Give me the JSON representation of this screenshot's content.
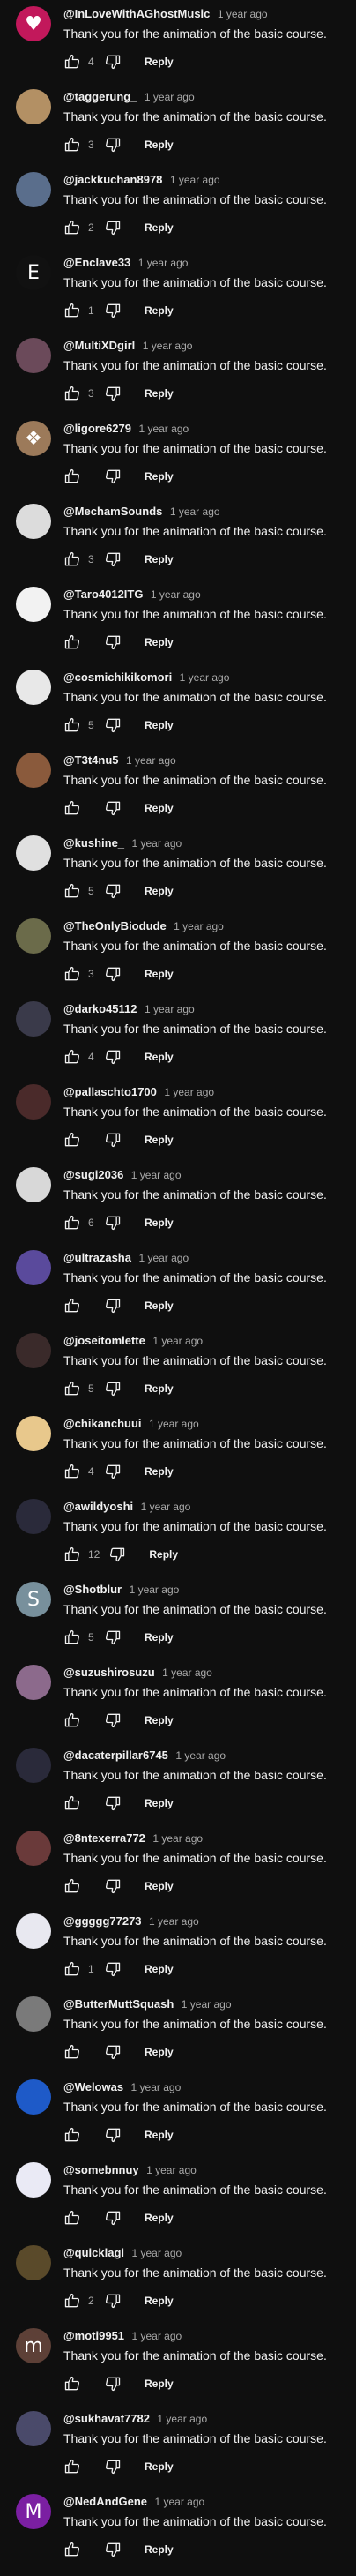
{
  "ui": {
    "reply_label": "Reply",
    "like_icon": "thumb-up-icon",
    "dislike_icon": "thumb-down-icon"
  },
  "comments": [
    {
      "author": "@InLoveWithAGhostMusic",
      "time": "1 year ago",
      "text": "Thank you for the animation of the basic course.",
      "likes": "4",
      "avatar": {
        "bg": "#c2185b",
        "glyph": "♥"
      }
    },
    {
      "author": "@taggerung_",
      "time": "1 year ago",
      "text": "Thank you for the animation of the basic course.",
      "likes": "3",
      "avatar": {
        "bg": "#b39064",
        "glyph": ""
      }
    },
    {
      "author": "@jackkuchan8978",
      "time": "1 year ago",
      "text": "Thank you for the animation of the basic course.",
      "likes": "2",
      "avatar": {
        "bg": "#5a6e8c",
        "glyph": ""
      }
    },
    {
      "author": "@Enclave33",
      "time": "1 year ago",
      "text": "Thank you for the animation of the basic course.",
      "likes": "1",
      "avatar": {
        "bg": "#111111",
        "glyph": "E"
      }
    },
    {
      "author": "@MultiXDgirl",
      "time": "1 year ago",
      "text": "Thank you for the animation of the basic course.",
      "likes": "3",
      "avatar": {
        "bg": "#6b4a5a",
        "glyph": ""
      }
    },
    {
      "author": "@ligore6279",
      "time": "1 year ago",
      "text": "Thank you for the animation of the basic course.",
      "likes": "",
      "avatar": {
        "bg": "#9c7a5a",
        "glyph": "❖"
      }
    },
    {
      "author": "@MechamSounds",
      "time": "1 year ago",
      "text": "Thank you for the animation of the basic course.",
      "likes": "3",
      "avatar": {
        "bg": "#dcdcdc",
        "glyph": ""
      }
    },
    {
      "author": "@Taro4012ITG",
      "time": "1 year ago",
      "text": "Thank you for the animation of the basic course.",
      "likes": "",
      "avatar": {
        "bg": "#f2f2f2",
        "glyph": ""
      }
    },
    {
      "author": "@cosmichikikomori",
      "time": "1 year ago",
      "text": "Thank you for the animation of the basic course.",
      "likes": "5",
      "avatar": {
        "bg": "#e8e8e8",
        "glyph": ""
      }
    },
    {
      "author": "@T3t4nu5",
      "time": "1 year ago",
      "text": "Thank you for the animation of the basic course.",
      "likes": "",
      "avatar": {
        "bg": "#8a5a3c",
        "glyph": ""
      }
    },
    {
      "author": "@kushine_",
      "time": "1 year ago",
      "text": "Thank you for the animation of the basic course.",
      "likes": "5",
      "avatar": {
        "bg": "#e0e0e0",
        "glyph": ""
      }
    },
    {
      "author": "@TheOnlyBiodude",
      "time": "1 year ago",
      "text": "Thank you for the animation of the basic course.",
      "likes": "3",
      "avatar": {
        "bg": "#6b6b4a",
        "glyph": ""
      }
    },
    {
      "author": "@darko45112",
      "time": "1 year ago",
      "text": "Thank you for the animation of the basic course.",
      "likes": "4",
      "avatar": {
        "bg": "#3a3a4a",
        "glyph": ""
      }
    },
    {
      "author": "@pallaschto1700",
      "time": "1 year ago",
      "text": "Thank you for the animation of the basic course.",
      "likes": "",
      "avatar": {
        "bg": "#4a2a2a",
        "glyph": ""
      }
    },
    {
      "author": "@sugi2036",
      "time": "1 year ago",
      "text": "Thank you for the animation of the basic course.",
      "likes": "6",
      "avatar": {
        "bg": "#d8d8d8",
        "glyph": ""
      }
    },
    {
      "author": "@ultrazasha",
      "time": "1 year ago",
      "text": "Thank you for the animation of the basic course.",
      "likes": "",
      "avatar": {
        "bg": "#5a4a9c",
        "glyph": ""
      }
    },
    {
      "author": "@joseitomlette",
      "time": "1 year ago",
      "text": "Thank you for the animation of the basic course.",
      "likes": "5",
      "avatar": {
        "bg": "#3a2a2a",
        "glyph": ""
      }
    },
    {
      "author": "@chikanchuui",
      "time": "1 year ago",
      "text": "Thank you for the animation of the basic course.",
      "likes": "4",
      "avatar": {
        "bg": "#e8c88c",
        "glyph": ""
      }
    },
    {
      "author": "@awildyoshi",
      "time": "1 year ago",
      "text": "Thank you for the animation of the basic course.",
      "likes": "12",
      "avatar": {
        "bg": "#2a2a3a",
        "glyph": ""
      }
    },
    {
      "author": "@Shotblur",
      "time": "1 year ago",
      "text": "Thank you for the animation of the basic course.",
      "likes": "5",
      "avatar": {
        "bg": "#78909c",
        "glyph": "S"
      }
    },
    {
      "author": "@suzushirosuzu",
      "time": "1 year ago",
      "text": "Thank you for the animation of the basic course.",
      "likes": "",
      "avatar": {
        "bg": "#8c6a8c",
        "glyph": ""
      }
    },
    {
      "author": "@dacaterpillar6745",
      "time": "1 year ago",
      "text": "Thank you for the animation of the basic course.",
      "likes": "",
      "avatar": {
        "bg": "#2a2a3a",
        "glyph": ""
      }
    },
    {
      "author": "@8ntexerra772",
      "time": "1 year ago",
      "text": "Thank you for the animation of the basic course.",
      "likes": "",
      "avatar": {
        "bg": "#6a3a3a",
        "glyph": ""
      }
    },
    {
      "author": "@ggggg77273",
      "time": "1 year ago",
      "text": "Thank you for the animation of the basic course.",
      "likes": "1",
      "avatar": {
        "bg": "#e8e8f0",
        "glyph": ""
      }
    },
    {
      "author": "@ButterMuttSquash",
      "time": "1 year ago",
      "text": "Thank you for the animation of the basic course.",
      "likes": "",
      "avatar": {
        "bg": "#7a7a7a",
        "glyph": ""
      }
    },
    {
      "author": "@Welowas",
      "time": "1 year ago",
      "text": "Thank you for the animation of the basic course.",
      "likes": "",
      "avatar": {
        "bg": "#1e5ac8",
        "glyph": ""
      }
    },
    {
      "author": "@somebnnuy",
      "time": "1 year ago",
      "text": "Thank you for the animation of the basic course.",
      "likes": "",
      "avatar": {
        "bg": "#eaeaf5",
        "glyph": ""
      }
    },
    {
      "author": "@quicklagi",
      "time": "1 year ago",
      "text": "Thank you for the animation of the basic course.",
      "likes": "2",
      "avatar": {
        "bg": "#5a4a2a",
        "glyph": ""
      }
    },
    {
      "author": "@moti9951",
      "time": "1 year ago",
      "text": "Thank you for the animation of the basic course.",
      "likes": "",
      "avatar": {
        "bg": "#5d4037",
        "glyph": "m"
      }
    },
    {
      "author": "@sukhavat7782",
      "time": "1 year ago",
      "text": "Thank you for the animation of the basic course.",
      "likes": "",
      "avatar": {
        "bg": "#4a4a6a",
        "glyph": ""
      }
    },
    {
      "author": "@NedAndGene",
      "time": "1 year ago",
      "text": "Thank you for the animation of the basic course.",
      "likes": "",
      "avatar": {
        "bg": "#7b1fa2",
        "glyph": "M"
      }
    }
  ]
}
